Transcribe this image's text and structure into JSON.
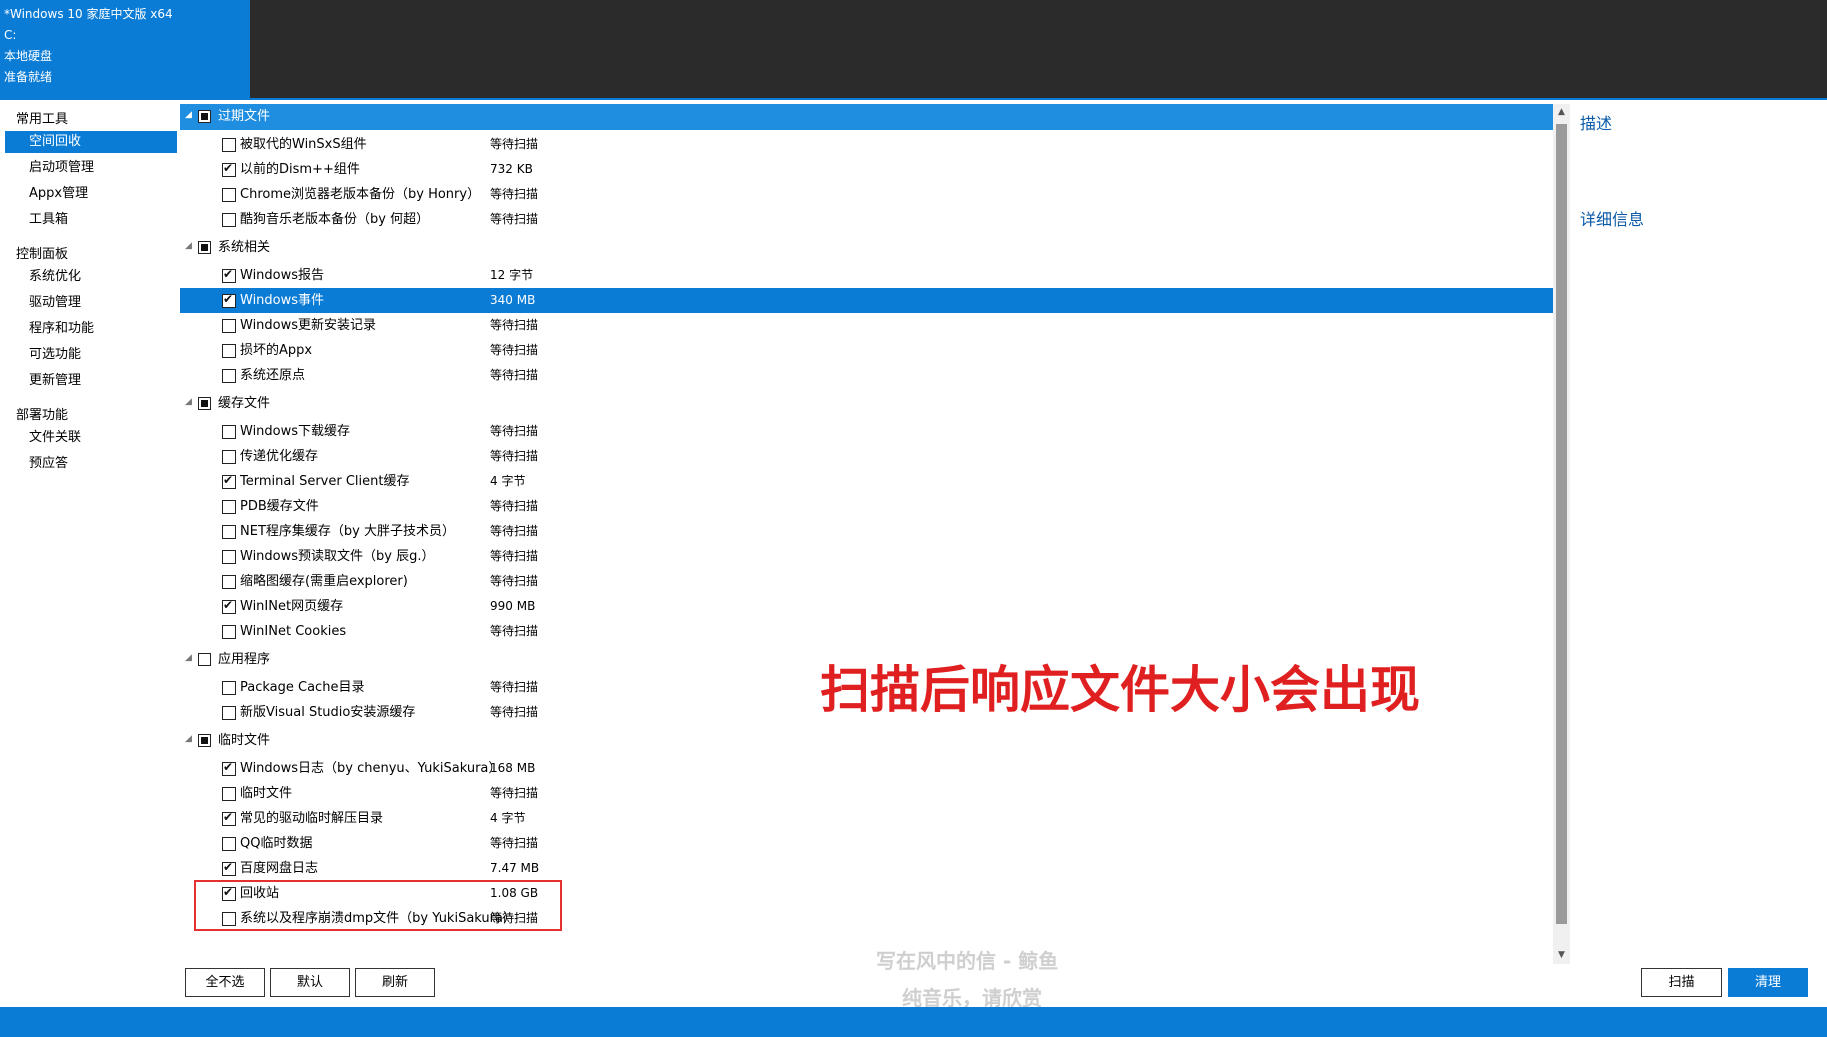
{
  "image_info": {
    "name": "*Windows 10 家庭中文版 x64",
    "drive": "C:",
    "disk": "本地硬盘",
    "status": "准备就绪"
  },
  "nav": {
    "groups": [
      {
        "title": "常用工具",
        "items": [
          "空间回收",
          "启动项管理",
          "Appx管理",
          "工具箱"
        ]
      },
      {
        "title": "控制面板",
        "items": [
          "系统优化",
          "驱动管理",
          "程序和功能",
          "可选功能",
          "更新管理"
        ]
      },
      {
        "title": "部署功能",
        "items": [
          "文件关联",
          "预应答"
        ]
      }
    ],
    "active_item": "空间回收"
  },
  "categories": [
    {
      "label": "过期文件",
      "state": "partial",
      "items": [
        {
          "label": "被取代的WinSxS组件",
          "size": "等待扫描",
          "checked": false
        },
        {
          "label": "以前的Dism++组件",
          "size": "732 KB",
          "checked": true
        },
        {
          "label": "Chrome浏览器老版本备份（by Honry）",
          "size": "等待扫描",
          "checked": false
        },
        {
          "label": "酷狗音乐老版本备份（by 何超）",
          "size": "等待扫描",
          "checked": false
        }
      ]
    },
    {
      "label": "系统相关",
      "state": "partial",
      "items": [
        {
          "label": "Windows报告",
          "size": "12 字节",
          "checked": true
        },
        {
          "label": "Windows事件",
          "size": "340 MB",
          "checked": true
        },
        {
          "label": "Windows更新安装记录",
          "size": "等待扫描",
          "checked": false
        },
        {
          "label": "损坏的Appx",
          "size": "等待扫描",
          "checked": false
        },
        {
          "label": "系统还原点",
          "size": "等待扫描",
          "checked": false
        }
      ]
    },
    {
      "label": "缓存文件",
      "state": "partial",
      "items": [
        {
          "label": "Windows下载缓存",
          "size": "等待扫描",
          "checked": false
        },
        {
          "label": "传递优化缓存",
          "size": "等待扫描",
          "checked": false
        },
        {
          "label": "Terminal Server Client缓存",
          "size": "4 字节",
          "checked": true
        },
        {
          "label": "PDB缓存文件",
          "size": "等待扫描",
          "checked": false
        },
        {
          "label": "NET程序集缓存（by 大胖子技术员）",
          "size": "等待扫描",
          "checked": false
        },
        {
          "label": "Windows预读取文件（by 辰g.）",
          "size": "等待扫描",
          "checked": false
        },
        {
          "label": "缩略图缓存(需重启explorer)",
          "size": "等待扫描",
          "checked": false
        },
        {
          "label": "WinINet网页缓存",
          "size": "990 MB",
          "checked": true
        },
        {
          "label": "WinINet Cookies",
          "size": "等待扫描",
          "checked": false
        }
      ]
    },
    {
      "label": "应用程序",
      "state": "unchecked",
      "items": [
        {
          "label": "Package Cache目录",
          "size": "等待扫描",
          "checked": false
        },
        {
          "label": "新版Visual Studio安装源缓存",
          "size": "等待扫描",
          "checked": false
        }
      ]
    },
    {
      "label": "临时文件",
      "state": "partial",
      "items": [
        {
          "label": "Windows日志（by chenyu、YukiSakura）",
          "size": "168 MB",
          "checked": true
        },
        {
          "label": "临时文件",
          "size": "等待扫描",
          "checked": false
        },
        {
          "label": "常见的驱动临时解压目录",
          "size": "4 字节",
          "checked": true
        },
        {
          "label": "QQ临时数据",
          "size": "等待扫描",
          "checked": false
        },
        {
          "label": "百度网盘日志",
          "size": "7.47 MB",
          "checked": true
        },
        {
          "label": "回收站",
          "size": "1.08 GB",
          "checked": true
        },
        {
          "label": "系统以及程序崩溃dmp文件（by YukiSakura）",
          "size": "等待扫描",
          "checked": false
        }
      ]
    }
  ],
  "selected_category": "过期文件",
  "highlighted_item": "Windows事件",
  "annotation": "扫描后响应文件大小会出现",
  "right_panel": {
    "description_title": "描述",
    "detail_title": "详细信息"
  },
  "buttons": {
    "deselect_all": "全不选",
    "default": "默认",
    "refresh": "刷新",
    "scan": "扫描",
    "clean": "清理"
  },
  "watermark": {
    "line1": "写在风中的信 - 鲸鱼",
    "line2": "纯音乐，请欣赏"
  },
  "icons": {
    "expand": "collapse-triangle-icon",
    "scroll_up": "chevron-up-icon",
    "scroll_down": "chevron-down-icon"
  },
  "colors": {
    "accent": "#0a7cd6",
    "annotation": "#e02020",
    "title_bar": "#2b2b2b"
  }
}
